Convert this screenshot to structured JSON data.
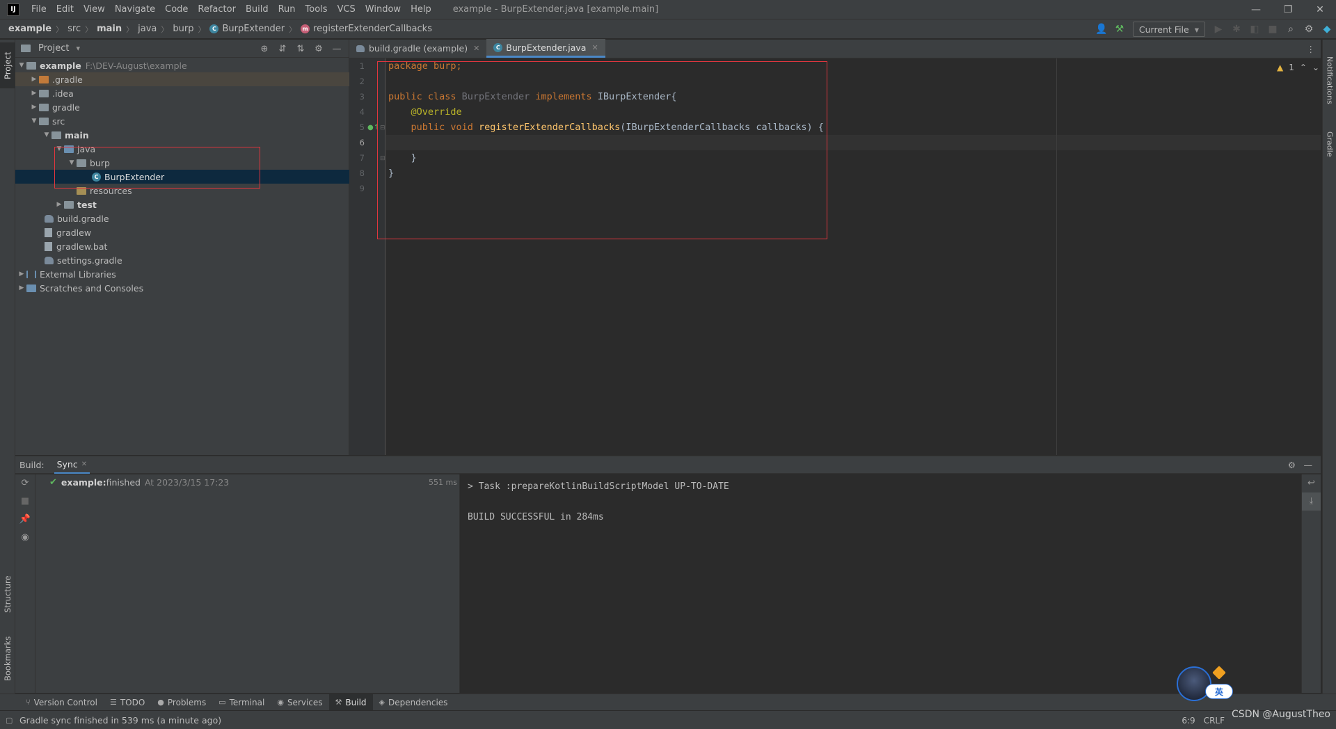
{
  "app": {
    "logo": "IJ",
    "window_title": "example - BurpExtender.java [example.main]",
    "menu": [
      "File",
      "Edit",
      "View",
      "Navigate",
      "Code",
      "Refactor",
      "Build",
      "Run",
      "Tools",
      "VCS",
      "Window",
      "Help"
    ],
    "window_controls": {
      "minimize": "—",
      "restore": "❐",
      "close": "✕"
    }
  },
  "breadcrumb": {
    "items": [
      "example",
      "src",
      "main",
      "java",
      "burp",
      "BurpExtender",
      "registerExtenderCallbacks"
    ],
    "separator": "〉"
  },
  "toolbar": {
    "run_config": "Current File",
    "run_config_arrow": "▾",
    "icons": [
      "user-icon",
      "hammer-icon",
      "run-icon",
      "debug-icon",
      "coverage-icon",
      "stop-icon",
      "search-icon",
      "gear-icon",
      "jetbrains-icon"
    ]
  },
  "left_stripe": {
    "project": "Project",
    "structure": "Structure",
    "bookmarks": "Bookmarks"
  },
  "right_stripe": {
    "notifications": "Notifications",
    "gradle": "Gradle"
  },
  "project_panel": {
    "title": "Project",
    "dropdown": "▾",
    "root": {
      "name": "example",
      "path": "F:\\DEV-August\\example"
    },
    "tree": [
      ".gradle",
      ".idea",
      "gradle",
      "src",
      "main",
      "java",
      "burp",
      "BurpExtender",
      "resources",
      "test",
      "build.gradle",
      "gradlew",
      "gradlew.bat",
      "settings.gradle",
      "External Libraries",
      "Scratches and Consoles"
    ]
  },
  "editor": {
    "tabs": [
      {
        "label": "build.gradle (example)",
        "active": false
      },
      {
        "label": "BurpExtender.java",
        "active": true
      }
    ],
    "line_numbers": [
      "1",
      "2",
      "3",
      "4",
      "5",
      "6",
      "7",
      "8",
      "9"
    ],
    "code": {
      "l1_kw": "package",
      "l1_rest": " burp;",
      "l3_kw1": "public class",
      "l3_cls": " BurpExtender",
      "l3_kw2": " implements",
      "l3_rest": " IBurpExtender{",
      "l4_ann": "    @Override",
      "l5_kw": "    public void",
      "l5_fn": " registerExtenderCallbacks",
      "l5_rest": "(IBurpExtenderCallbacks callbacks) {",
      "l7": "    }",
      "l8": "}"
    },
    "inspection_count": "1",
    "cursor_line": 6
  },
  "build": {
    "header_label": "Build:",
    "tab": "Sync",
    "row_name": "example:",
    "row_status": " finished",
    "row_time": "At 2023/3/15 17:23",
    "row_ms": "551 ms",
    "console": [
      "> Task :prepareKotlinBuildScriptModel UP-TO-DATE",
      "",
      "BUILD SUCCESSFUL in 284ms"
    ]
  },
  "bottom_tools": [
    {
      "label": "Version Control",
      "icon": "⑂"
    },
    {
      "label": "TODO",
      "icon": "☰"
    },
    {
      "label": "Problems",
      "icon": "●"
    },
    {
      "label": "Terminal",
      "icon": "▭"
    },
    {
      "label": "Services",
      "icon": "◉"
    },
    {
      "label": "Build",
      "icon": "⚒",
      "active": true
    },
    {
      "label": "Dependencies",
      "icon": "◈"
    }
  ],
  "status": {
    "message": "Gradle sync finished in 539 ms (a minute ago)",
    "position": "6:9",
    "encoding": "CRLF",
    "watermark": "CSDN @AugustTheo"
  },
  "avatar_badge": "英",
  "colors": {
    "accent": "#4a88c7",
    "highlight_box": "#e0363e",
    "success": "#5fb85f"
  }
}
